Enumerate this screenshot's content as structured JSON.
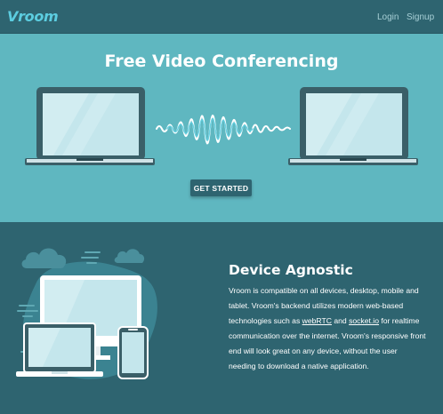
{
  "nav": {
    "logo": "Vroom",
    "login": "Login",
    "signup": "Signup"
  },
  "hero": {
    "title": "Free Video Conferencing",
    "cta": "GET STARTED"
  },
  "feature": {
    "title": "Device Agnostic",
    "text_1": "Vroom is compatible on all devices, desktop, mobile and tablet. Vroom's backend utilizes modern web-based technologies such as ",
    "link_webrtc": "webRTC",
    "text_2": " and ",
    "link_socketio": "socket.io",
    "text_3": " for realtime communication over the internet. Vroom's responsive front end will look great on any device, without the user needing to download a native application."
  },
  "colors": {
    "nav_bg": "#2e6470",
    "hero_bg": "#5fb7c0",
    "accent": "#5ccde0",
    "laptop_body": "#3a5f68",
    "screen": "#c4e6ec"
  },
  "icons": [
    "laptop-icon",
    "soundwave-icon",
    "cloud-icon",
    "devices-icon"
  ]
}
